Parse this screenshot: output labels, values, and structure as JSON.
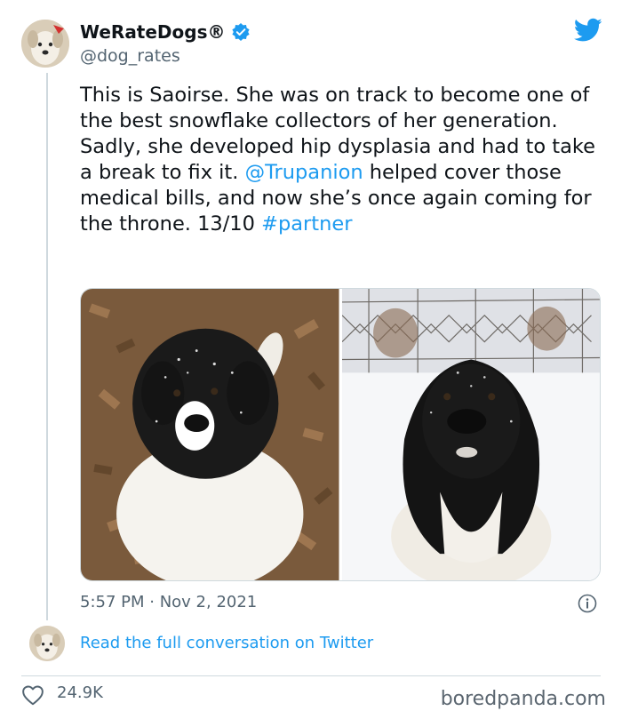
{
  "author": {
    "display_name": "WeRateDogs®",
    "handle": "@dog_rates"
  },
  "tweet": {
    "text_before": "This is Saoirse. She was on track to become one of the best snowflake collectors of her generation. Sadly, she developed hip dysplasia and had to take a break to fix it. ",
    "mention": "@Trupanion",
    "text_middle": " helped cover those medical bills, and now she’s once again coming for the throne. 13/10 ",
    "hashtag": "#partner",
    "timestamp": "5:57 PM · Nov 2, 2021"
  },
  "footer": {
    "read_link": "Read the full conversation on Twitter",
    "likes": "24.9K"
  },
  "watermark": "boredpanda.com",
  "colors": {
    "link": "#1d9bf0",
    "text": "#0f1419",
    "muted": "#536471"
  },
  "icons": [
    "verified-badge-icon",
    "twitter-bird-icon",
    "info-icon",
    "heart-icon"
  ]
}
